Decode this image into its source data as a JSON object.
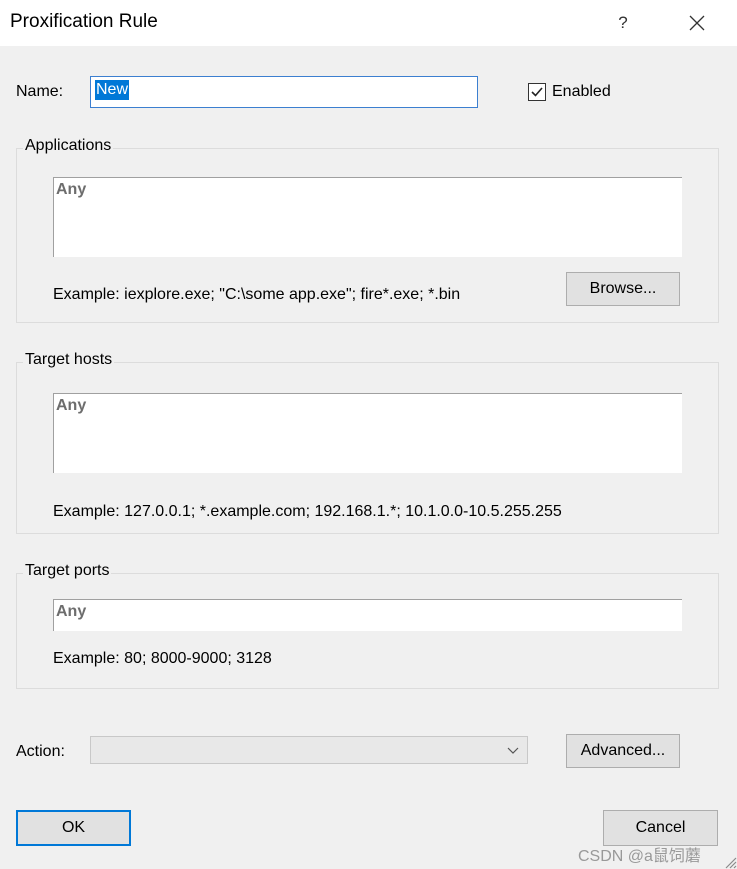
{
  "window": {
    "title": "Proxification Rule",
    "help_label": "?"
  },
  "name": {
    "label": "Name:",
    "value": "New"
  },
  "enabled": {
    "label": "Enabled",
    "checked": true
  },
  "applications": {
    "title": "Applications",
    "value": "Any",
    "example": "Example: iexplore.exe; \"C:\\some app.exe\"; fire*.exe; *.bin",
    "browse_label": "Browse..."
  },
  "target_hosts": {
    "title": "Target hosts",
    "value": "Any",
    "example": "Example: 127.0.0.1; *.example.com; 192.168.1.*; 10.1.0.0-10.5.255.255"
  },
  "target_ports": {
    "title": "Target ports",
    "value": "Any",
    "example": "Example: 80; 8000-9000; 3128"
  },
  "action": {
    "label": "Action:",
    "value": "",
    "advanced_label": "Advanced..."
  },
  "footer": {
    "ok_label": "OK",
    "cancel_label": "Cancel",
    "watermark": "CSDN @a鼠饲蘑"
  },
  "colors": {
    "accent": "#0078d7",
    "placeholder_text": "#6d6d6d"
  }
}
